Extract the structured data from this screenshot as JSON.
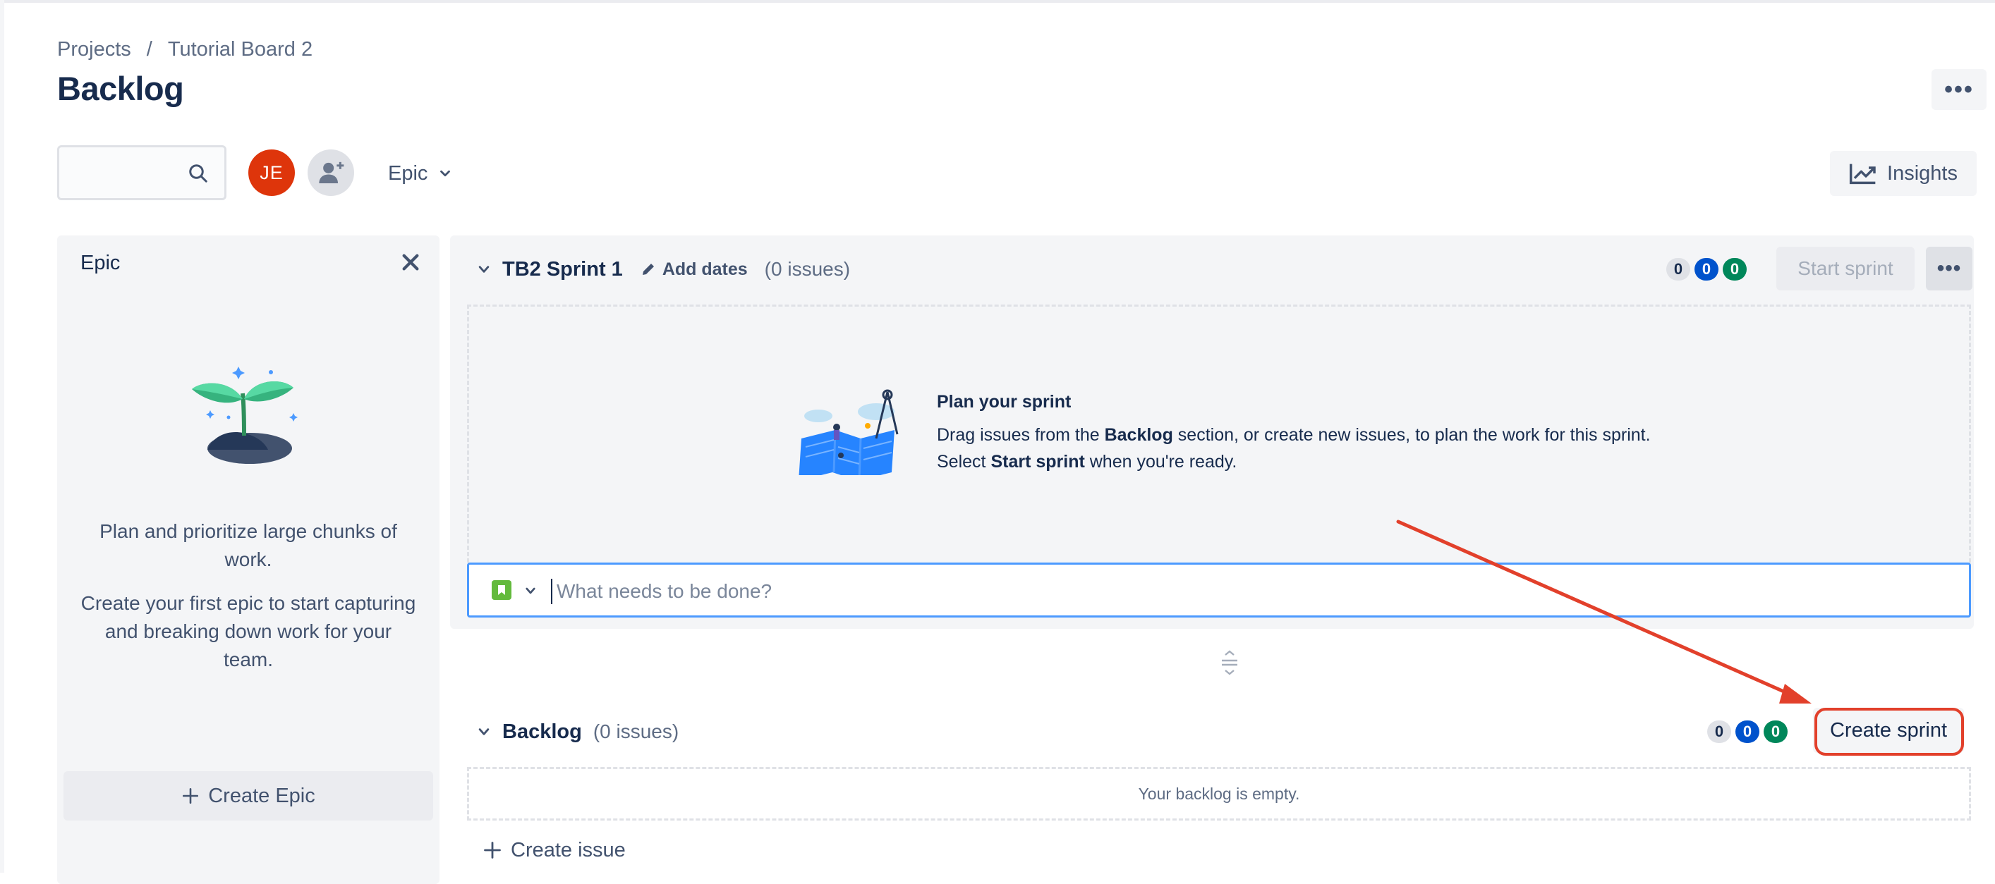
{
  "breadcrumb": {
    "root": "Projects",
    "separator": "/",
    "current": "Tutorial Board 2"
  },
  "page": {
    "title": "Backlog",
    "more_icon": "more-horizontal-icon"
  },
  "toolbar": {
    "search_placeholder": "",
    "search_icon": "search-icon",
    "avatar_initials": "JE",
    "avatar_color": "#de350b",
    "add_people_icon": "add-person-icon",
    "epic_filter_label": "Epic",
    "insights_label": "Insights",
    "insights_icon": "chart-trend-icon"
  },
  "epic_panel": {
    "title": "Epic",
    "description_1": "Plan and prioritize large chunks of work.",
    "description_2": "Create your first epic to start capturing and breaking down work for your team.",
    "create_label": "Create Epic"
  },
  "sprint": {
    "name": "TB2 Sprint 1",
    "add_dates_label": "Add dates",
    "issue_count": "(0 issues)",
    "counts": {
      "todo": "0",
      "in_progress": "0",
      "done": "0"
    },
    "start_label": "Start sprint",
    "empty_title": "Plan your sprint",
    "empty_text_1": "Drag issues from the ",
    "empty_bold_1": "Backlog",
    "empty_text_2": " section, or create new issues, to plan the work for this sprint. Select ",
    "empty_bold_2": "Start sprint",
    "empty_text_3": " when you're ready.",
    "create_placeholder": "What needs to be done?"
  },
  "backlog": {
    "name": "Backlog",
    "issue_count": "(0 issues)",
    "counts": {
      "todo": "0",
      "in_progress": "0",
      "done": "0"
    },
    "create_sprint_label": "Create sprint",
    "empty_text": "Your backlog is empty.",
    "create_issue_label": "Create issue"
  },
  "colors": {
    "accent": "#0052cc",
    "success": "#00875a",
    "annotation": "#e2402b",
    "focus_border": "#4c9aff"
  }
}
